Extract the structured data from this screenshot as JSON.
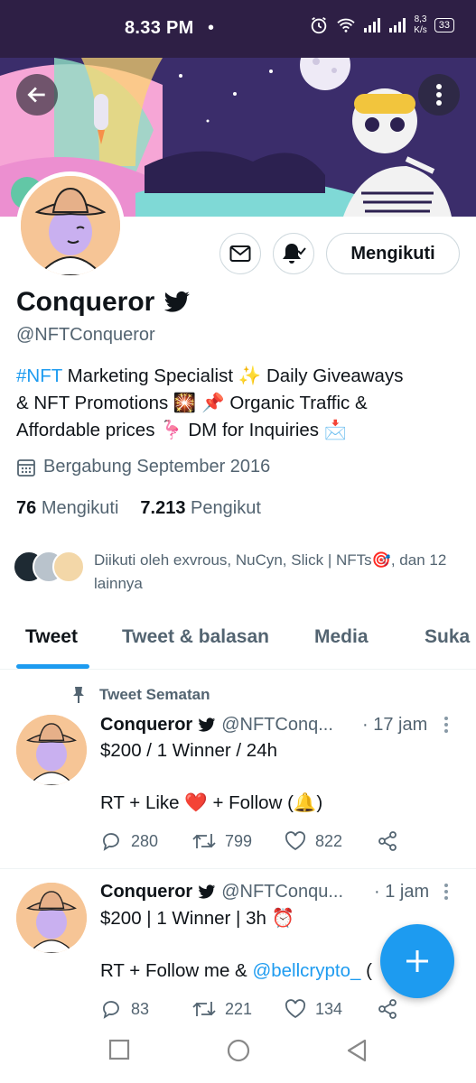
{
  "status_bar": {
    "time": "8.33 PM",
    "dot": "•",
    "net_speed_value": "8,3",
    "net_speed_unit": "K/s",
    "battery": "33"
  },
  "profile": {
    "name": "Conqueror",
    "handle": "@NFTConqueror",
    "bio": {
      "hashtag": "#NFT",
      "line1": " Marketing Specialist ✨ Daily Giveaways",
      "line2": "& NFT Promotions 🎇   📌 Organic Traffic &",
      "line3": "Affordable prices 🦩  DM for Inquiries 📩"
    },
    "joined": "Bergabung September 2016",
    "following_count": "76",
    "following_label": "Mengikuti",
    "followers_count": "7.213",
    "followers_label": "Pengikut",
    "followed_by": "Diikuti oleh exvrous, NuCyn, Slick | NFTs🎯, dan 12 lainnya",
    "follow_button": "Mengikuti"
  },
  "tabs": [
    "Tweet",
    "Tweet & balasan",
    "Media",
    "Suka"
  ],
  "pinned_label": "Tweet Sematan",
  "tweets": [
    {
      "name": "Conqueror",
      "handle": "@NFTConq...",
      "time": "· 17 jam",
      "line1": "$200 / 1 Winner / 24h",
      "line2": "RT + Like ❤️ + Follow (🔔)",
      "replies": "280",
      "retweets": "799",
      "likes": "822"
    },
    {
      "name": "Conqueror",
      "handle": "@NFTConqu...",
      "time": "· 1 jam",
      "line1": "$200 | 1 Winner | 3h ⏰",
      "line2_prefix": "RT + Follow me & ",
      "line2_mention": "@bellcrypto_",
      "line2_suffix": " (",
      "replies": "83",
      "retweets": "221",
      "likes": "134"
    }
  ],
  "colors": {
    "accent": "#1d9bf0",
    "status_bar": "#2e1f45",
    "text_secondary": "#536471"
  }
}
